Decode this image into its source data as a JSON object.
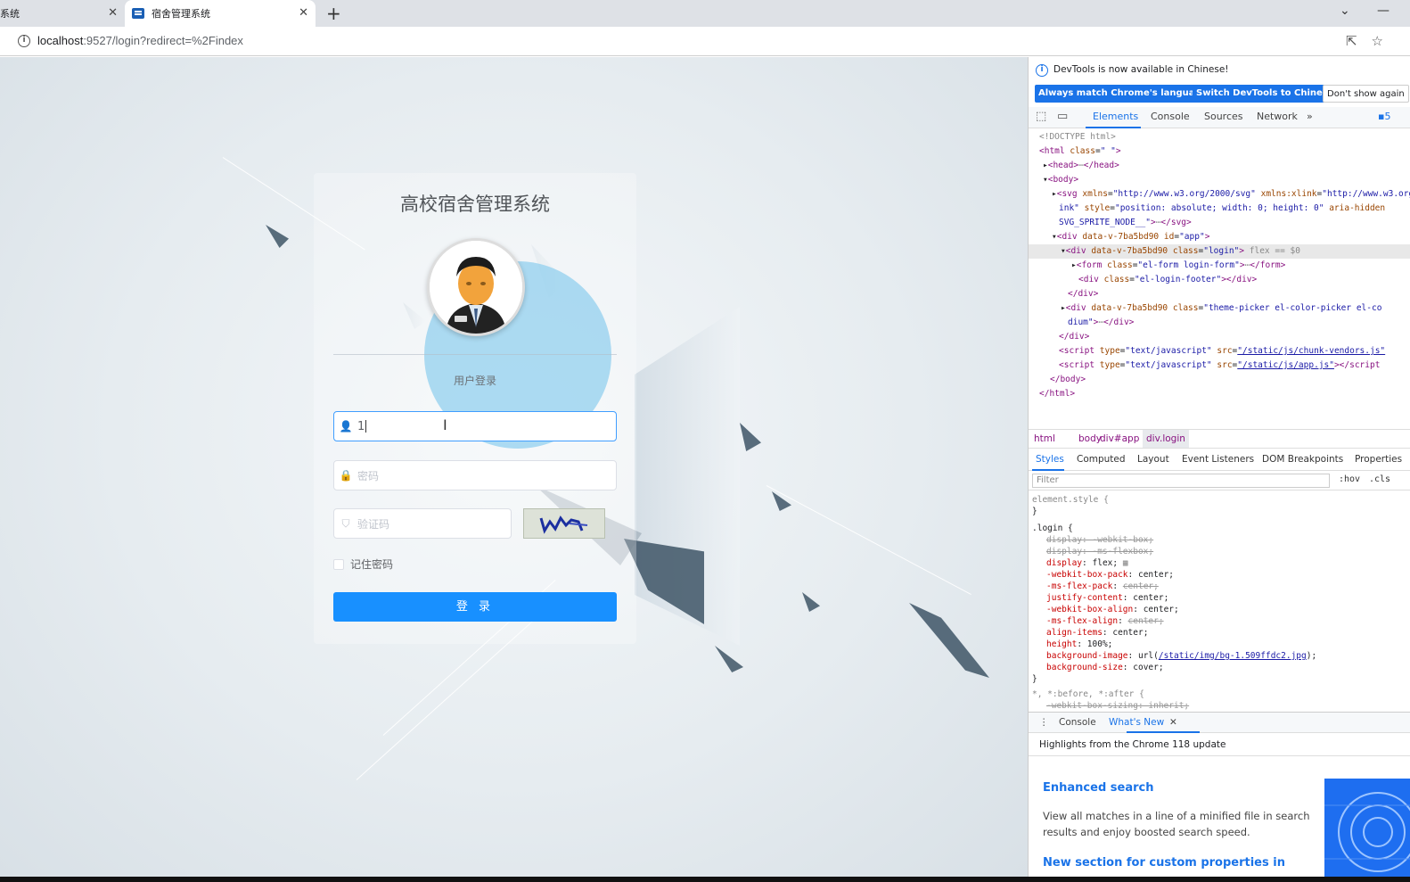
{
  "browser": {
    "tabs": [
      {
        "label": "系统"
      },
      {
        "label": "宿舍管理系统"
      }
    ],
    "url_host": "localhost",
    "url_rest": ":9527/login?redirect=%2Findex",
    "new_tab_symbol": "+",
    "window_controls": {
      "dropdown": "⌄",
      "minimize": "—"
    }
  },
  "login": {
    "title": "高校宿舍管理系统",
    "subtitle": "用户登录",
    "username": {
      "value": "1",
      "icon": "user-icon"
    },
    "password": {
      "placeholder": "密码",
      "icon": "lock-icon"
    },
    "captcha": {
      "placeholder": "验证码",
      "icon": "shield-icon",
      "image_text": "b4r7"
    },
    "remember_label": "记住密码",
    "login_button": "登 录"
  },
  "devtools": {
    "notice": "DevTools is now available in Chinese!",
    "btn_match": "Always match Chrome's language",
    "btn_switch": "Switch DevTools to Chinese",
    "btn_dont_show": "Don't show again",
    "tabs": [
      "Elements",
      "Console",
      "Sources",
      "Network"
    ],
    "more_tabs": "»",
    "issues_count": "5",
    "breadcrumbs": [
      "html",
      "body",
      "div#app",
      "div.login"
    ],
    "style_tabs": [
      "Styles",
      "Computed",
      "Layout",
      "Event Listeners",
      "DOM Breakpoints",
      "Properties"
    ],
    "filter_placeholder": "Filter",
    "filter_hov": ":hov",
    "filter_cls": ".cls",
    "drawer_tabs": [
      "Console",
      "What's New"
    ],
    "whats_new_header": "Highlights from the Chrome 118 update",
    "whats_new_items": [
      {
        "title": "Enhanced search",
        "body": "View all matches in a line of a minified file in search results and enjoy boosted search speed."
      },
      {
        "title": "New section for custom properties in",
        "body": ""
      }
    ]
  },
  "colors": {
    "primary": "#1890ff",
    "devtools_accent": "#1a73e8",
    "bubble": "#8ccdee",
    "deco": "#3e5566"
  }
}
